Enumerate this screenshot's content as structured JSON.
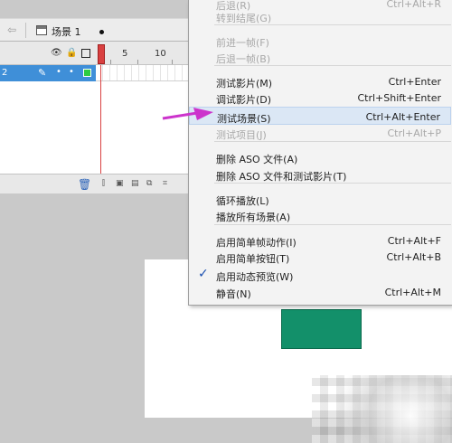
{
  "scene": {
    "back_arrow": "⇦",
    "label": "场景 1"
  },
  "timeline": {
    "ruler": [
      "5",
      "10"
    ],
    "layer_number": "2"
  },
  "menu": {
    "items": [
      {
        "label": "后退(R)",
        "shortcut": "Ctrl+Alt+R",
        "disabled": true
      },
      {
        "label": "转到结尾(G)",
        "shortcut": "",
        "disabled": true
      },
      {
        "label": "前进一帧(F)",
        "shortcut": "",
        "disabled": true
      },
      {
        "label": "后退一帧(B)",
        "shortcut": "",
        "disabled": true
      },
      {
        "label": "测试影片(M)",
        "shortcut": "Ctrl+Enter",
        "disabled": false
      },
      {
        "label": "调试影片(D)",
        "shortcut": "Ctrl+Shift+Enter",
        "disabled": false
      },
      {
        "label": "测试场景(S)",
        "shortcut": "Ctrl+Alt+Enter",
        "disabled": false,
        "highlighted": true
      },
      {
        "label": "测试项目(J)",
        "shortcut": "Ctrl+Alt+P",
        "disabled": true
      },
      {
        "label": "删除 ASO 文件(A)",
        "shortcut": "",
        "disabled": false
      },
      {
        "label": "删除 ASO 文件和测试影片(T)",
        "shortcut": "",
        "disabled": false
      },
      {
        "label": "循环播放(L)",
        "shortcut": "",
        "disabled": false
      },
      {
        "label": "播放所有场景(A)",
        "shortcut": "",
        "disabled": false
      },
      {
        "label": "启用简单帧动作(I)",
        "shortcut": "Ctrl+Alt+F",
        "disabled": false
      },
      {
        "label": "启用简单按钮(T)",
        "shortcut": "Ctrl+Alt+B",
        "disabled": false
      },
      {
        "label": "启用动态预览(W)",
        "shortcut": "",
        "disabled": false,
        "checked": true
      },
      {
        "label": "静音(N)",
        "shortcut": "Ctrl+Alt+M",
        "disabled": false
      }
    ]
  },
  "colors": {
    "highlight": "#dbe7f5",
    "arrow": "#cc33cc",
    "shape": "#13906a",
    "layer_selected": "#3f8fd8"
  }
}
